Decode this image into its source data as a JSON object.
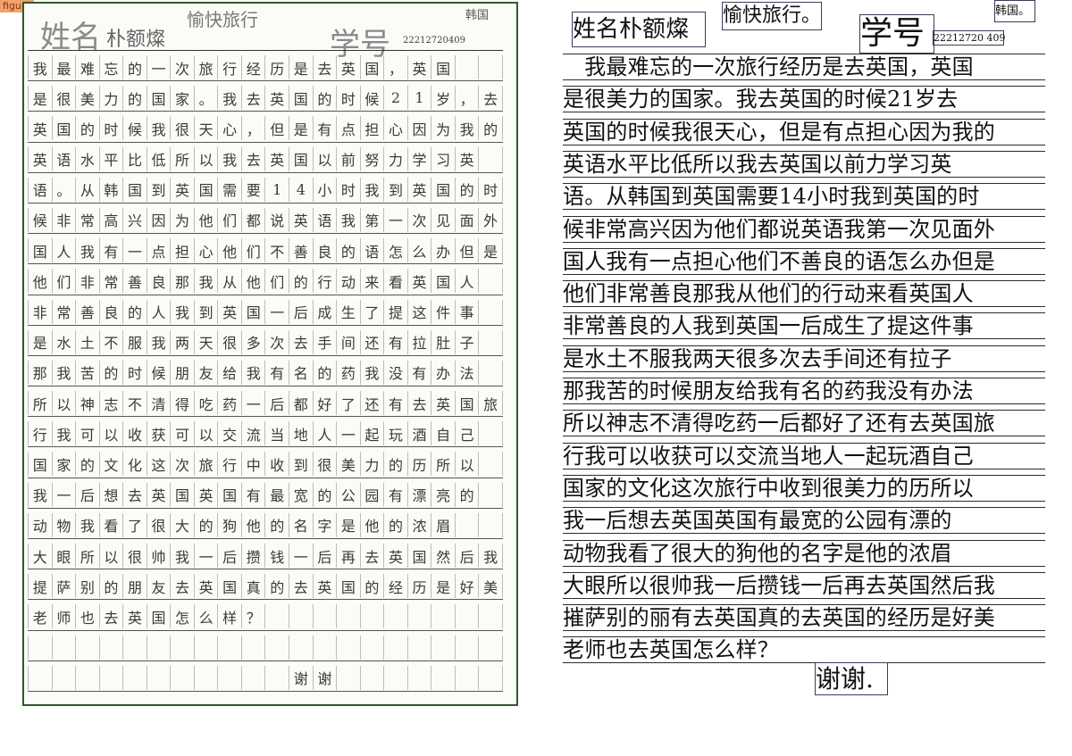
{
  "figure_tag": "figure",
  "left": {
    "name_label": "姓名",
    "name_value": "朴额燦",
    "title": "愉快旅行",
    "id_label": "学号",
    "id_value": "22212720409",
    "corner": "韩国",
    "rows": [
      "我最难忘的一次旅行经历是去英国，英国",
      "是很美力的国家。我去英国的时候21岁，去",
      "英国的时候我很天心，但是有点担心因为我的",
      "英语水平比低所以我去英国以前努力学习英",
      "语。从韩国到英国需要14小时我到英国的时",
      "候非常高兴因为他们都说英语我第一次见面外",
      "国人我有一点担心他们不善良的语怎么办但是",
      "他们非常善良那我从他们的行动来看英国人",
      "非常善良的人我到英国一后成生了提这件事",
      "是水土不服我两天很多次去手间还有拉肚子",
      "那我苦的时候朋友给我有名的药我没有办法",
      "所以神志不清得吃药一后都好了还有去英国旅",
      "行我可以收获可以交流当地人一起玩酒自己",
      "国家的文化这次旅行中收到很美力的历所以",
      "我一后想去英国英国有最宽的公园有漂亮的",
      "动物我看了很大的狗他的名字是他的浓眉",
      "大眼所以很帅我一后攒钱一后再去英国然后我",
      "提萨别的朋友去英国真的去英国的经历是好美",
      "老师也去英国怎么样？",
      "",
      "谢谢"
    ]
  },
  "right": {
    "name_line": "姓名朴额燦",
    "title": "愉快旅行。",
    "corner": "韩国。",
    "id_label": "学号",
    "id_value": "22212720 409",
    "lines": [
      "　我最难忘的一次旅行经历是去英国，英国",
      "是很美力的国家。我去英国的时候21岁去",
      "英国的时候我很天心，但是有点担心因为我的",
      "英语水平比低所以我去英国以前力学习英",
      "语。从韩国到英国需要14小时我到英国的时",
      "候非常高兴因为他们都说英语我第一次见面外",
      "国人我有一点担心他们不善良的语怎么办但是",
      "他们非常善良那我从他们的行动来看英国人",
      "非常善良的人我到英国一后成生了提这件事",
      "是水土不服我两天很多次去手间还有拉子",
      "那我苦的时候朋友给我有名的药我没有办法",
      "所以神志不清得吃药一后都好了还有去英国旅",
      "行我可以收获可以交流当地人一起玩酒自己",
      "国家的文化这次旅行中收到很美力的历所以",
      "我一后想去英国英国有最宽的公园有漂的",
      "动物我看了很大的狗他的名字是他的浓眉",
      "大眼所以很帅我一后攒钱一后再去英国然后我",
      "摧萨别的丽有去英国真的去英国的经历是好美",
      "老师也去英国怎么样？"
    ],
    "closing": "谢谢."
  }
}
